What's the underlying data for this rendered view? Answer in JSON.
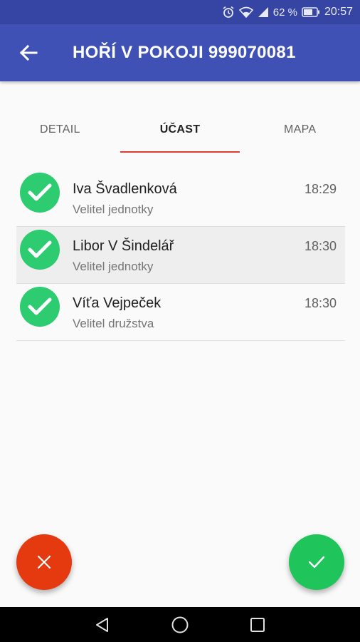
{
  "status_bar": {
    "battery_percent": "62 %",
    "time": "20:57",
    "icons": [
      "alarm-icon",
      "wifi-icon",
      "signal-icon",
      "battery-icon"
    ]
  },
  "app_bar": {
    "title": "HOŘÍ V POKOJI 999070081",
    "back_icon": "arrow-back-icon"
  },
  "tabs": [
    {
      "label": "DETAIL",
      "active": false
    },
    {
      "label": "ÚČAST",
      "active": true
    },
    {
      "label": "MAPA",
      "active": false
    }
  ],
  "participants": [
    {
      "name": "Iva Švadlenková",
      "role": "Velitel jednotky",
      "time": "18:29",
      "status_icon": "check-icon"
    },
    {
      "name": "Libor V Šindelář",
      "role": "Velitel jednotky",
      "time": "18:30",
      "status_icon": "check-icon"
    },
    {
      "name": "Víťa Vejpeček",
      "role": "Velitel družstva",
      "time": "18:30",
      "status_icon": "check-icon"
    }
  ],
  "fabs": {
    "decline_icon": "close-icon",
    "accept_icon": "check-icon"
  },
  "colors": {
    "primary": "#3f51b5",
    "status_bar": "#3644a3",
    "accent_tab": "#e53935",
    "check_green": "#2ecc71",
    "fab_red": "#e53910",
    "fab_green": "#1fc45a"
  },
  "nav_bar": {
    "icons": [
      "nav-back-icon",
      "nav-home-icon",
      "nav-recents-icon"
    ]
  }
}
